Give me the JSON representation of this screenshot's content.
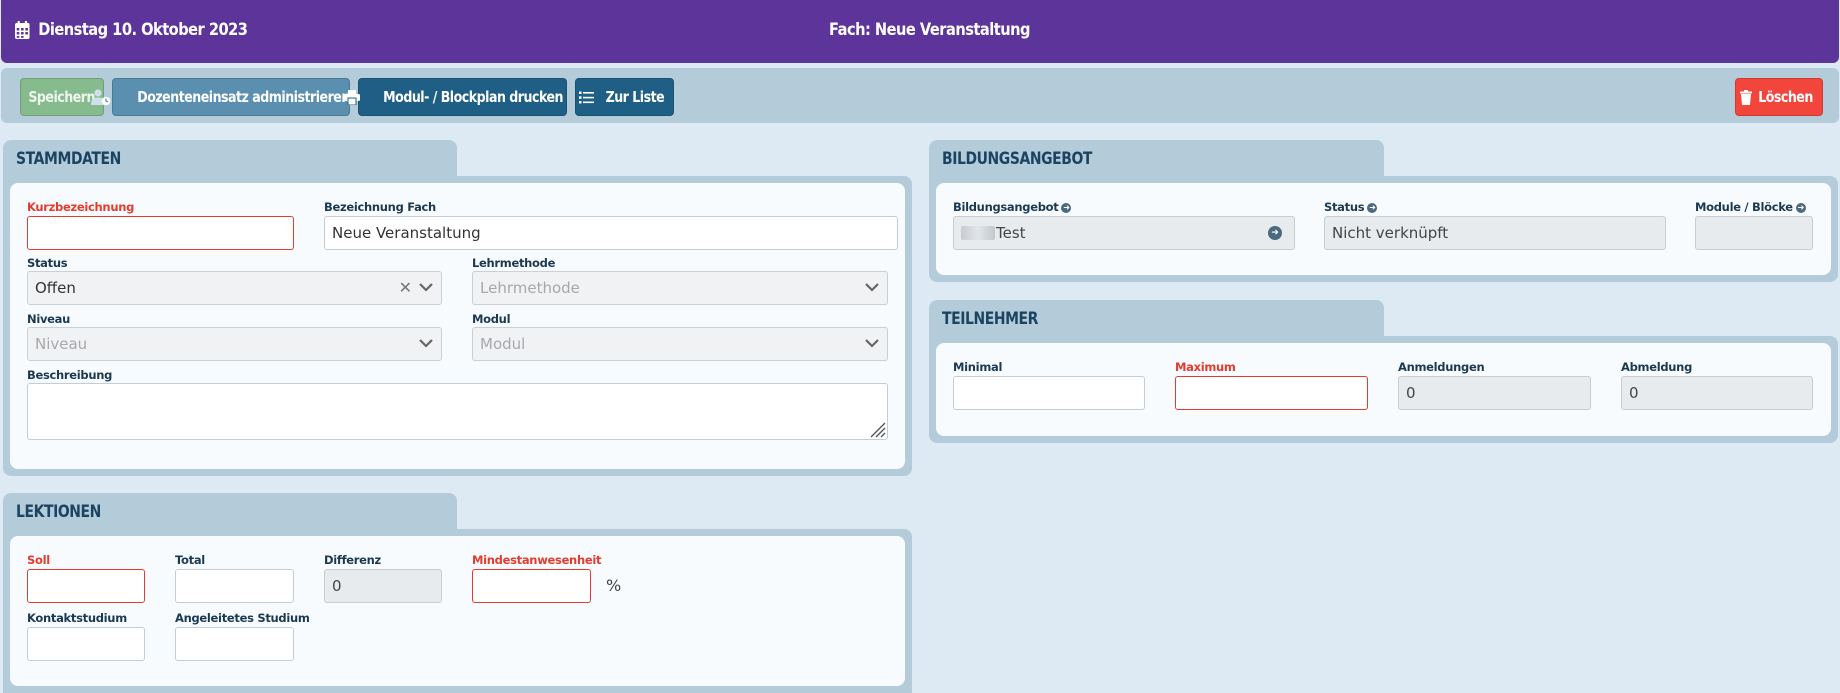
{
  "header": {
    "date": "Dienstag 10. Oktober 2023",
    "title": "Fach: Neue Veranstaltung"
  },
  "toolbar": {
    "save": "Speichern",
    "doz": "Dozenteneinsatz administrieren",
    "print": "Modul- / Blockplan drucken",
    "list": "Zur Liste",
    "delete": "Löschen"
  },
  "stammdaten": {
    "heading": "STAMMDATEN",
    "kurz_label": "Kurzbezeichnung",
    "kurz_value": "",
    "bez_label": "Bezeichnung Fach",
    "bez_value": "Neue Veranstaltung",
    "status_label": "Status",
    "status_value": "Offen",
    "lehr_label": "Lehrmethode",
    "lehr_placeholder": "Lehrmethode",
    "niveau_label": "Niveau",
    "niveau_placeholder": "Niveau",
    "modul_label": "Modul",
    "modul_placeholder": "Modul",
    "besch_label": "Beschreibung"
  },
  "lektionen": {
    "heading": "LEKTIONEN",
    "soll_label": "Soll",
    "total_label": "Total",
    "diff_label": "Differenz",
    "diff_value": "0",
    "mind_label": "Mindestanwesenheit",
    "pct": "%",
    "kontakt_label": "Kontaktstudium",
    "angeleitet_label": "Angeleitetes Studium"
  },
  "bildungsangebot": {
    "heading": "BILDUNGSANGEBOT",
    "ba_label": "Bildungsangebot",
    "ba_value": "Test",
    "status_label": "Status",
    "status_value": "Nicht verknüpft",
    "module_label": "Module / Blöcke"
  },
  "teilnehmer": {
    "heading": "TEILNEHMER",
    "min_label": "Minimal",
    "max_label": "Maximum",
    "anm_label": "Anmeldungen",
    "anm_value": "0",
    "abm_label": "Abmeldung",
    "abm_value": "0"
  },
  "colors": {
    "header": "#5d359a",
    "panel": "#b4cbd9",
    "required": "#e53b2f",
    "delete": "#f2453b",
    "primary": "#1f5f86"
  },
  "icons": [
    "calendar-icon",
    "user-clock-icon",
    "print-icon",
    "list-icon",
    "trash-icon",
    "chevron-down-icon",
    "clear-icon",
    "arrow-circle-icon"
  ]
}
